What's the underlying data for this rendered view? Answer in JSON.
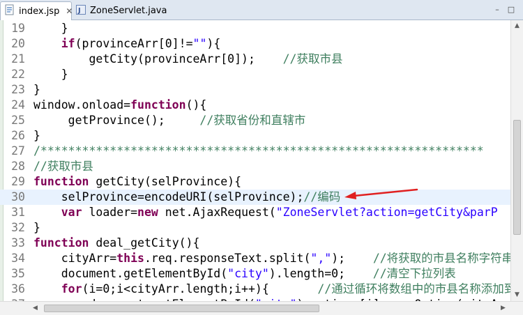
{
  "tabs": [
    {
      "label": "index.jsp",
      "icon": "jsp-file-icon",
      "close": "✕"
    },
    {
      "label": "ZoneServlet.java",
      "icon": "java-file-icon"
    }
  ],
  "window_buttons": {
    "minimize": "–",
    "maximize": "□"
  },
  "colors": {
    "keyword": "#7f0055",
    "string": "#2a00ff",
    "comment": "#3f7f5f",
    "line_number": "#787878",
    "current_line": "#e8f2fe",
    "annotation_arrow": "#e02020"
  },
  "code_lines": [
    {
      "n": "19",
      "tokens": [
        {
          "t": "    }"
        }
      ]
    },
    {
      "n": "20",
      "tokens": [
        {
          "t": "    "
        },
        {
          "t": "if",
          "c": "kw"
        },
        {
          "t": "(provinceArr[0]!="
        },
        {
          "t": "\"\"",
          "c": "str"
        },
        {
          "t": "){"
        }
      ]
    },
    {
      "n": "21",
      "tokens": [
        {
          "t": "        getCity(provinceArr[0]);    "
        },
        {
          "t": "//获取市县",
          "c": "com"
        }
      ]
    },
    {
      "n": "22",
      "tokens": [
        {
          "t": "    }"
        }
      ]
    },
    {
      "n": "23",
      "tokens": [
        {
          "t": "}"
        }
      ]
    },
    {
      "n": "24",
      "tokens": [
        {
          "t": "window.onload="
        },
        {
          "t": "function",
          "c": "kw"
        },
        {
          "t": "(){"
        }
      ]
    },
    {
      "n": "25",
      "tokens": [
        {
          "t": "     getProvince();     "
        },
        {
          "t": "//获取省份和直辖市",
          "c": "com"
        }
      ]
    },
    {
      "n": "26",
      "tokens": [
        {
          "t": "}"
        }
      ]
    },
    {
      "n": "27",
      "tokens": [
        {
          "t": "/****************************************************************",
          "c": "com"
        }
      ]
    },
    {
      "n": "28",
      "tokens": [
        {
          "t": "//获取市县",
          "c": "com"
        }
      ]
    },
    {
      "n": "29",
      "tokens": [
        {
          "t": "function",
          "c": "kw"
        },
        {
          "t": " getCity(selProvince){"
        }
      ]
    },
    {
      "n": "30",
      "current": true,
      "tokens": [
        {
          "t": "    selProvince=encodeURI(selProvince);"
        },
        {
          "t": "//编码",
          "c": "com"
        }
      ]
    },
    {
      "n": "31",
      "tokens": [
        {
          "t": "    "
        },
        {
          "t": "var",
          "c": "kw"
        },
        {
          "t": " loader="
        },
        {
          "t": "new",
          "c": "kw"
        },
        {
          "t": " net.AjaxRequest("
        },
        {
          "t": "\"ZoneServlet?action=getCity&parP",
          "c": "str"
        }
      ]
    },
    {
      "n": "32",
      "tokens": [
        {
          "t": "}"
        }
      ]
    },
    {
      "n": "33",
      "tokens": [
        {
          "t": "function",
          "c": "kw"
        },
        {
          "t": " deal_getCity(){"
        }
      ]
    },
    {
      "n": "34",
      "tokens": [
        {
          "t": "    cityArr="
        },
        {
          "t": "this",
          "c": "kw"
        },
        {
          "t": ".req.responseText.split("
        },
        {
          "t": "\",\"",
          "c": "str"
        },
        {
          "t": ");    "
        },
        {
          "t": "//将获取的市县名称字符串分割",
          "c": "com"
        }
      ]
    },
    {
      "n": "35",
      "tokens": [
        {
          "t": "    document.getElementById("
        },
        {
          "t": "\"city\"",
          "c": "str"
        },
        {
          "t": ").length=0;    "
        },
        {
          "t": "//清空下拉列表",
          "c": "com"
        }
      ]
    },
    {
      "n": "36",
      "tokens": [
        {
          "t": "    "
        },
        {
          "t": "for",
          "c": "kw"
        },
        {
          "t": "(i=0;i<cityArr.length;i++){       "
        },
        {
          "t": "//通过循环将数组中的市县名称添加到下拉",
          "c": "com"
        }
      ]
    },
    {
      "n": "37",
      "tokens": [
        {
          "t": "        document.getElementById("
        },
        {
          "t": "\"city\"",
          "c": "str"
        },
        {
          "t": ").options[i]=new Option(cityArr"
        }
      ]
    }
  ]
}
